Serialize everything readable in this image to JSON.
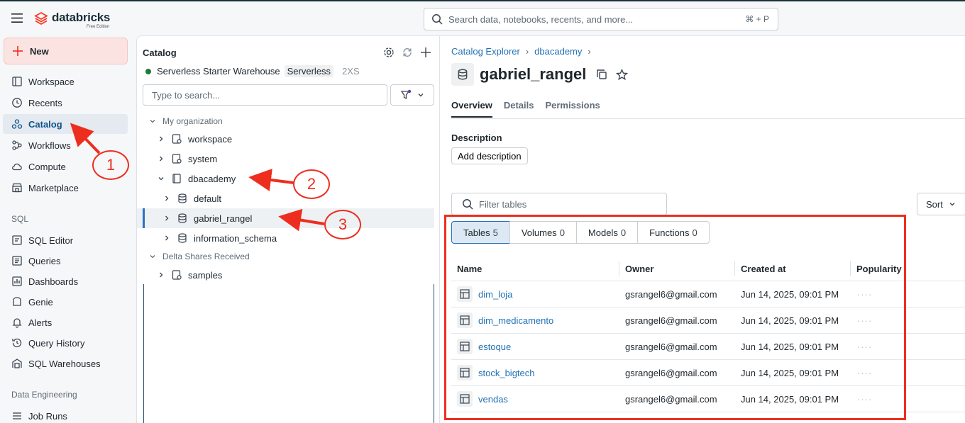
{
  "topbar": {
    "logo_text": "databricks",
    "logo_sub": "Free Edition",
    "search_placeholder": "Search data, notebooks, recents, and more...",
    "search_shortcut": "⌘ + P"
  },
  "nav": {
    "new_label": "New",
    "items": [
      {
        "label": "Workspace",
        "icon": "workspace-icon"
      },
      {
        "label": "Recents",
        "icon": "clock-icon"
      },
      {
        "label": "Catalog",
        "icon": "catalog-icon",
        "active": true
      },
      {
        "label": "Workflows",
        "icon": "workflows-icon"
      },
      {
        "label": "Compute",
        "icon": "cloud-icon"
      },
      {
        "label": "Marketplace",
        "icon": "store-icon"
      }
    ],
    "sql_section": "SQL",
    "sql_items": [
      {
        "label": "SQL Editor",
        "icon": "sql-editor-icon"
      },
      {
        "label": "Queries",
        "icon": "queries-icon"
      },
      {
        "label": "Dashboards",
        "icon": "dashboard-icon"
      },
      {
        "label": "Genie",
        "icon": "genie-icon"
      },
      {
        "label": "Alerts",
        "icon": "bell-icon"
      },
      {
        "label": "Query History",
        "icon": "history-icon"
      },
      {
        "label": "SQL Warehouses",
        "icon": "warehouse-icon"
      }
    ],
    "de_section": "Data Engineering",
    "de_items": [
      {
        "label": "Job Runs",
        "icon": "job-runs-icon"
      }
    ]
  },
  "catalog": {
    "title": "Catalog",
    "warehouse_name": "Serverless Starter Warehouse",
    "warehouse_type": "Serverless",
    "warehouse_size": "2XS",
    "search_placeholder": "Type to search...",
    "tree": {
      "my_org": "My organization",
      "workspace": "workspace",
      "system": "system",
      "dbacademy": "dbacademy",
      "default": "default",
      "gabriel_rangel": "gabriel_rangel",
      "information_schema": "information_schema",
      "delta_shares": "Delta Shares Received",
      "samples": "samples"
    }
  },
  "main": {
    "breadcrumb": [
      "Catalog Explorer",
      "dbacademy"
    ],
    "title": "gabriel_rangel",
    "tabs": [
      "Overview",
      "Details",
      "Permissions"
    ],
    "description_label": "Description",
    "add_description": "Add description",
    "filter_placeholder": "Filter tables",
    "sort_label": "Sort",
    "segments": [
      {
        "label": "Tables",
        "count": "5"
      },
      {
        "label": "Volumes",
        "count": "0"
      },
      {
        "label": "Models",
        "count": "0"
      },
      {
        "label": "Functions",
        "count": "0"
      }
    ],
    "columns": [
      "Name",
      "Owner",
      "Created at",
      "Popularity"
    ],
    "rows": [
      {
        "name": "dim_loja",
        "owner": "gsrangel6@gmail.com",
        "created": "Jun 14, 2025, 09:01 PM",
        "popularity": "····"
      },
      {
        "name": "dim_medicamento",
        "owner": "gsrangel6@gmail.com",
        "created": "Jun 14, 2025, 09:01 PM",
        "popularity": "····"
      },
      {
        "name": "estoque",
        "owner": "gsrangel6@gmail.com",
        "created": "Jun 14, 2025, 09:01 PM",
        "popularity": "····"
      },
      {
        "name": "stock_bigtech",
        "owner": "gsrangel6@gmail.com",
        "created": "Jun 14, 2025, 09:01 PM",
        "popularity": "····"
      },
      {
        "name": "vendas",
        "owner": "gsrangel6@gmail.com",
        "created": "Jun 14, 2025, 09:01 PM",
        "popularity": "····"
      }
    ]
  },
  "annotations": {
    "step1": "1",
    "step2": "2",
    "step3": "3",
    "color": "#ed2e1f"
  }
}
